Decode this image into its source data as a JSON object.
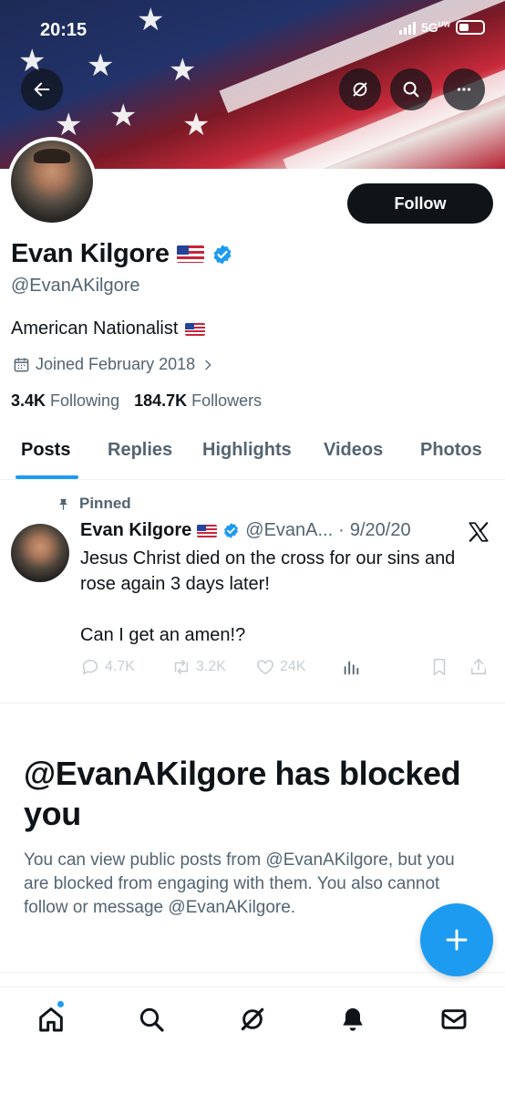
{
  "status_bar": {
    "time": "20:15",
    "network": "5G",
    "network_sup": "UW"
  },
  "header": {
    "back_icon": "arrow-left-icon",
    "grok_icon": "grok-slash-icon",
    "search_icon": "search-icon",
    "more_icon": "more-icon"
  },
  "profile": {
    "display_name": "Evan Kilgore",
    "handle": "@EvanAKilgore",
    "bio": "American Nationalist",
    "joined": "Joined February 2018",
    "following_count": "3.4K",
    "following_label": "Following",
    "followers_count": "184.7K",
    "followers_label": "Followers",
    "follow_button": "Follow",
    "verified": true
  },
  "tabs": [
    {
      "label": "Posts",
      "active": true
    },
    {
      "label": "Replies",
      "active": false
    },
    {
      "label": "Highlights",
      "active": false
    },
    {
      "label": "Videos",
      "active": false
    },
    {
      "label": "Photos",
      "active": false
    }
  ],
  "post": {
    "pinned_label": "Pinned",
    "author_name": "Evan Kilgore",
    "author_handle": "@EvanA...",
    "separator": "·",
    "date": "9/20/20",
    "text_line1": "Jesus Christ died on the cross for our sins and rose again 3 days later!",
    "text_line2": "Can I get an amen!?",
    "replies": "4.7K",
    "reposts": "3.2K",
    "likes": "24K"
  },
  "blocked": {
    "title": "@EvanAKilgore has blocked you",
    "body": "You can view public posts from @EvanAKilgore, but you are blocked from engaging with them. You also cannot follow or message @EvanAKilgore."
  },
  "bottom_nav": [
    "home-icon",
    "search-icon",
    "grok-icon",
    "notifications-icon",
    "messages-icon"
  ],
  "colors": {
    "accent": "#1d9bf0",
    "text": "#0f1419",
    "muted": "#536471",
    "follow_bg": "#0f1419"
  }
}
